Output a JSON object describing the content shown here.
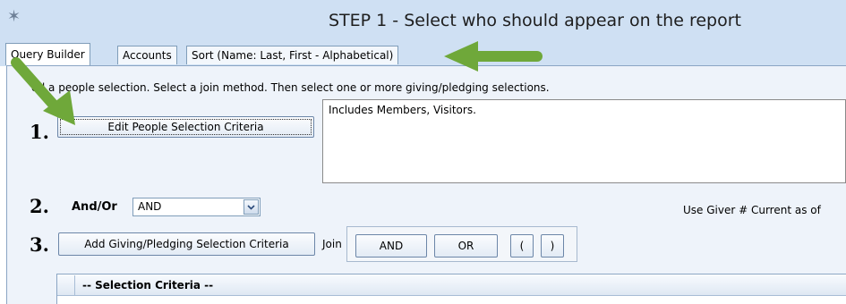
{
  "window": {
    "title": "STEP 1 - Select who should appear on the report"
  },
  "tabs": [
    {
      "label": "Query Builder",
      "active": true
    },
    {
      "label": "Accounts",
      "active": false
    },
    {
      "label": "Sort (Name: Last, First - Alphabetical)",
      "active": false
    }
  ],
  "instructions": "dd a people selection.  Select a join method.  Then select one or more giving/pledging selections.",
  "step1": {
    "number": "1.",
    "button_label": "Edit People Selection Criteria",
    "summary": "Includes Members, Visitors."
  },
  "step2": {
    "number": "2.",
    "label": "And/Or",
    "selected_value": "AND",
    "giver_label": "Use Giver # Current as of"
  },
  "step3": {
    "number": "3.",
    "button_label": "Add Giving/Pledging Selection Criteria",
    "join_label": "Join",
    "join_buttons": [
      "AND",
      "OR",
      "(",
      ")"
    ]
  },
  "grid": {
    "column_header": "-- Selection Criteria --"
  },
  "colors": {
    "titlebar": "#cfe0f3",
    "panel": "#eef3fa",
    "arrow_green": "#6fa83a"
  },
  "icons": [
    "app-icon",
    "chevron-down-icon",
    "green-arrow-annotation"
  ]
}
